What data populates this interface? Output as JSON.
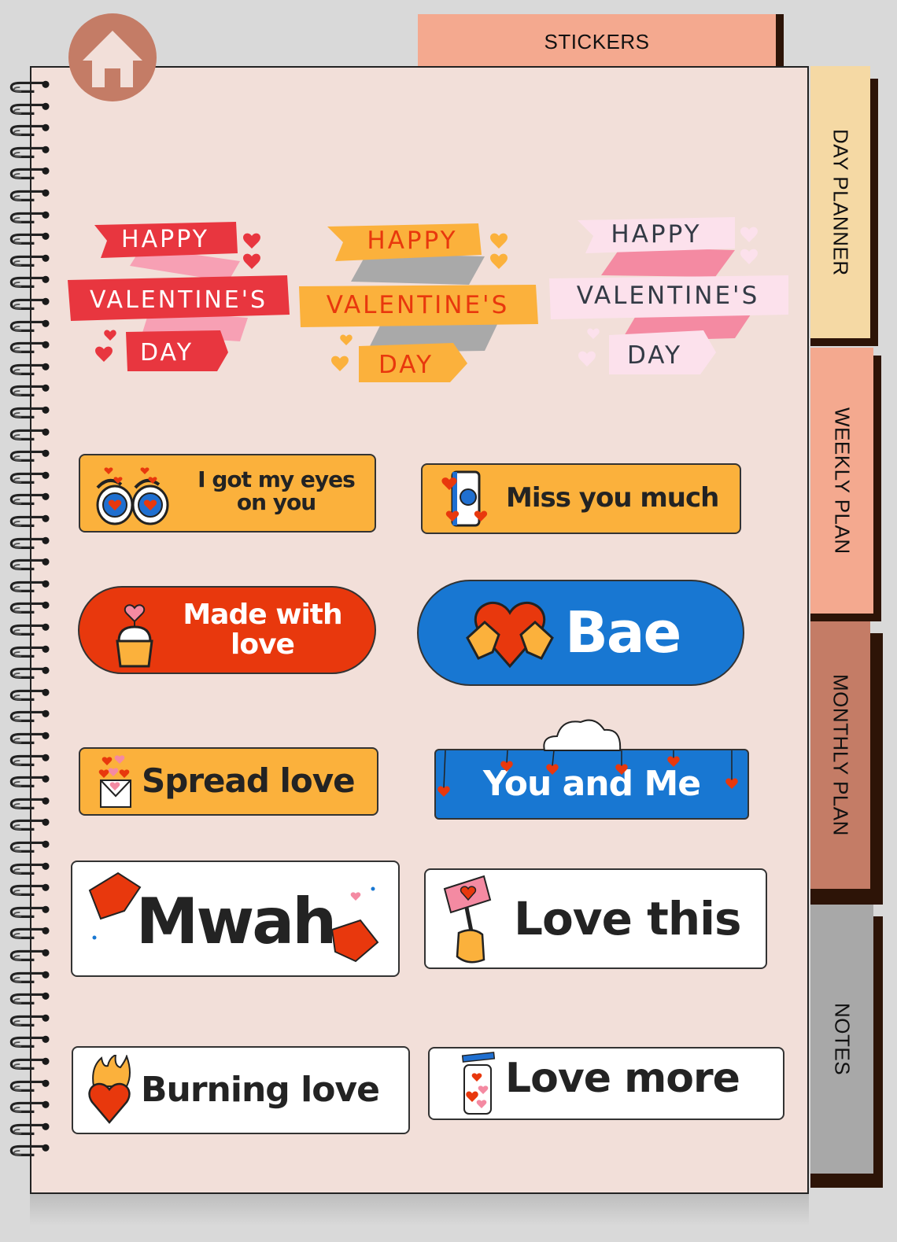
{
  "header": {
    "active_tab": "STICKERS"
  },
  "side_tabs": [
    {
      "label": "DAY PLANNER",
      "color": "#f5d9a4"
    },
    {
      "label": "WEEKLY PLAN",
      "color": "#f4a98f"
    },
    {
      "label": "MONTHLY PLAN",
      "color": "#c47c66"
    },
    {
      "label": "NOTES",
      "color": "#a8a8a8"
    }
  ],
  "colors": {
    "page_bg": "#f2dfd9",
    "tab_shadow": "#2d1407",
    "home_button": "#c47c66",
    "sticker_yellow": "#fbb13c",
    "sticker_red": "#e8380d",
    "sticker_blue": "#1877d2"
  },
  "banners": [
    {
      "line1": "HAPPY",
      "line2": "VALENTINE'S",
      "line3": "DAY",
      "ribbon": "#e8363f",
      "fold": "#f7a0b4",
      "text": "#ffffff",
      "heart": "#e8363f"
    },
    {
      "line1": "HAPPY",
      "line2": "VALENTINE'S",
      "line3": "DAY",
      "ribbon": "#fbb13c",
      "fold": "#a9a9a9",
      "text": "#e8380d",
      "heart": "#fbb13c"
    },
    {
      "line1": "HAPPY",
      "line2": "VALENTINE'S",
      "line3": "DAY",
      "ribbon": "#fce1ec",
      "fold": "#f48aa2",
      "text": "#333a45",
      "heart": "#fce1ec"
    }
  ],
  "stickers": {
    "eyes": {
      "line1": "I got my eyes",
      "line2": "on you"
    },
    "miss": {
      "text": "Miss you much"
    },
    "made": {
      "line1": "Made with",
      "line2": "love"
    },
    "bae": {
      "text": "Bae"
    },
    "spread": {
      "text": "Spread love"
    },
    "youme": {
      "text": "You and Me"
    },
    "mwah": {
      "text": "Mwah"
    },
    "lovethis": {
      "text": "Love this"
    },
    "burning": {
      "text": "Burning love"
    },
    "lovemore": {
      "text": "Love more"
    }
  }
}
